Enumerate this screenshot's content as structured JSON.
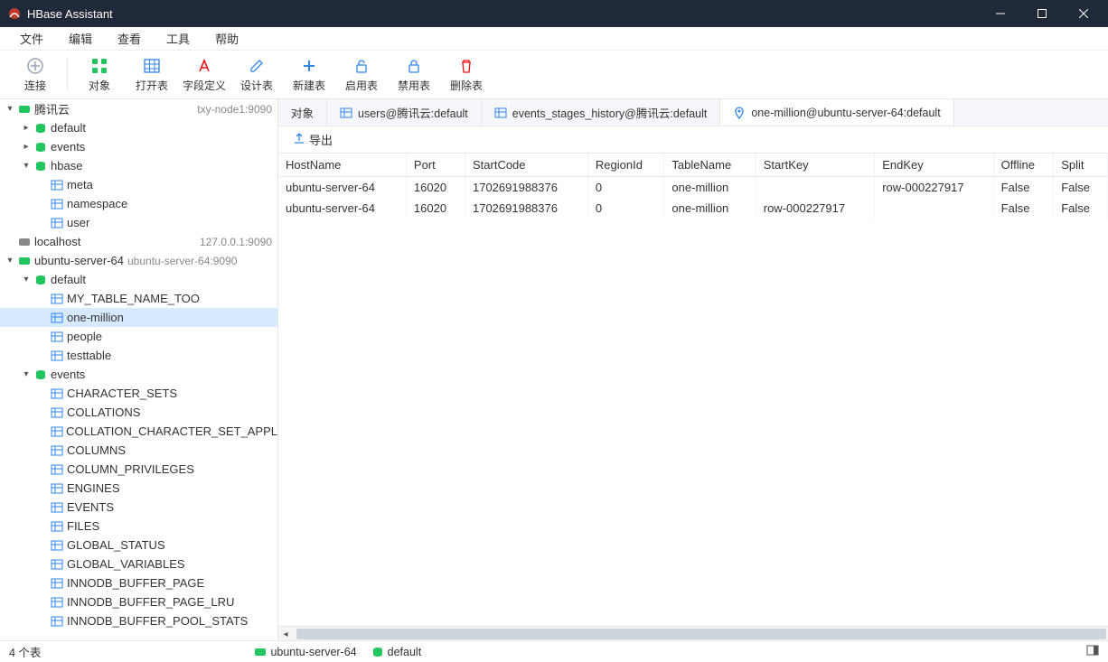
{
  "app_title": "HBase Assistant",
  "menu": {
    "items": [
      "文件",
      "编辑",
      "查看",
      "工具",
      "帮助"
    ]
  },
  "toolbar": {
    "connect": "连接",
    "objects": "对象",
    "open_table": "打开表",
    "field_def": "字段定义",
    "design_table": "设计表",
    "new_table": "新建表",
    "enable_table": "启用表",
    "disable_table": "禁用表",
    "delete_table": "删除表"
  },
  "tree": {
    "tencent": {
      "label": "腾讯云",
      "sub": "txy-node1:9090"
    },
    "default1": {
      "label": "default"
    },
    "events1": {
      "label": "events"
    },
    "hbase": {
      "label": "hbase"
    },
    "meta": {
      "label": "meta"
    },
    "namespace": {
      "label": "namespace"
    },
    "user": {
      "label": "user"
    },
    "localhost": {
      "label": "localhost",
      "sub": "127.0.0.1:9090"
    },
    "ubuntu": {
      "label": "ubuntu-server-64",
      "sub": "ubuntu-server-64:9090"
    },
    "default2": {
      "label": "default"
    },
    "mytable": {
      "label": "MY_TABLE_NAME_TOO"
    },
    "onemillion": {
      "label": "one-million"
    },
    "people": {
      "label": "people"
    },
    "testtable": {
      "label": "testtable"
    },
    "events2": {
      "label": "events"
    },
    "character_sets": {
      "label": "CHARACTER_SETS"
    },
    "collations": {
      "label": "COLLATIONS"
    },
    "collation_cs": {
      "label": "COLLATION_CHARACTER_SET_APPL"
    },
    "columns": {
      "label": "COLUMNS"
    },
    "column_priv": {
      "label": "COLUMN_PRIVILEGES"
    },
    "engines": {
      "label": "ENGINES"
    },
    "events_t": {
      "label": "EVENTS"
    },
    "files": {
      "label": "FILES"
    },
    "global_status": {
      "label": "GLOBAL_STATUS"
    },
    "global_vars": {
      "label": "GLOBAL_VARIABLES"
    },
    "innodb_bp": {
      "label": "INNODB_BUFFER_PAGE"
    },
    "innodb_bp_lru": {
      "label": "INNODB_BUFFER_PAGE_LRU"
    },
    "innodb_bp_stats": {
      "label": "INNODB_BUFFER_POOL_STATS"
    }
  },
  "tabs": {
    "objects": "对象",
    "users": "users@腾讯云:default",
    "events_stages": "events_stages_history@腾讯云:default",
    "onemillion": "one-million@ubuntu-server-64:default"
  },
  "subtoolbar": {
    "export": "导出"
  },
  "grid": {
    "headers": [
      "HostName",
      "Port",
      "StartCode",
      "RegionId",
      "TableName",
      "StartKey",
      "EndKey",
      "Offline",
      "Split"
    ],
    "rows": [
      {
        "HostName": "ubuntu-server-64",
        "Port": "16020",
        "StartCode": "1702691988376",
        "RegionId": "0",
        "TableName": "one-million",
        "StartKey": "",
        "EndKey": "row-000227917",
        "Offline": "False",
        "Split": "False"
      },
      {
        "HostName": "ubuntu-server-64",
        "Port": "16020",
        "StartCode": "1702691988376",
        "RegionId": "0",
        "TableName": "one-million",
        "StartKey": "row-000227917",
        "EndKey": "",
        "Offline": "False",
        "Split": "False"
      }
    ]
  },
  "statusbar": {
    "count": "4 个表",
    "server": "ubuntu-server-64",
    "ns": "default"
  }
}
